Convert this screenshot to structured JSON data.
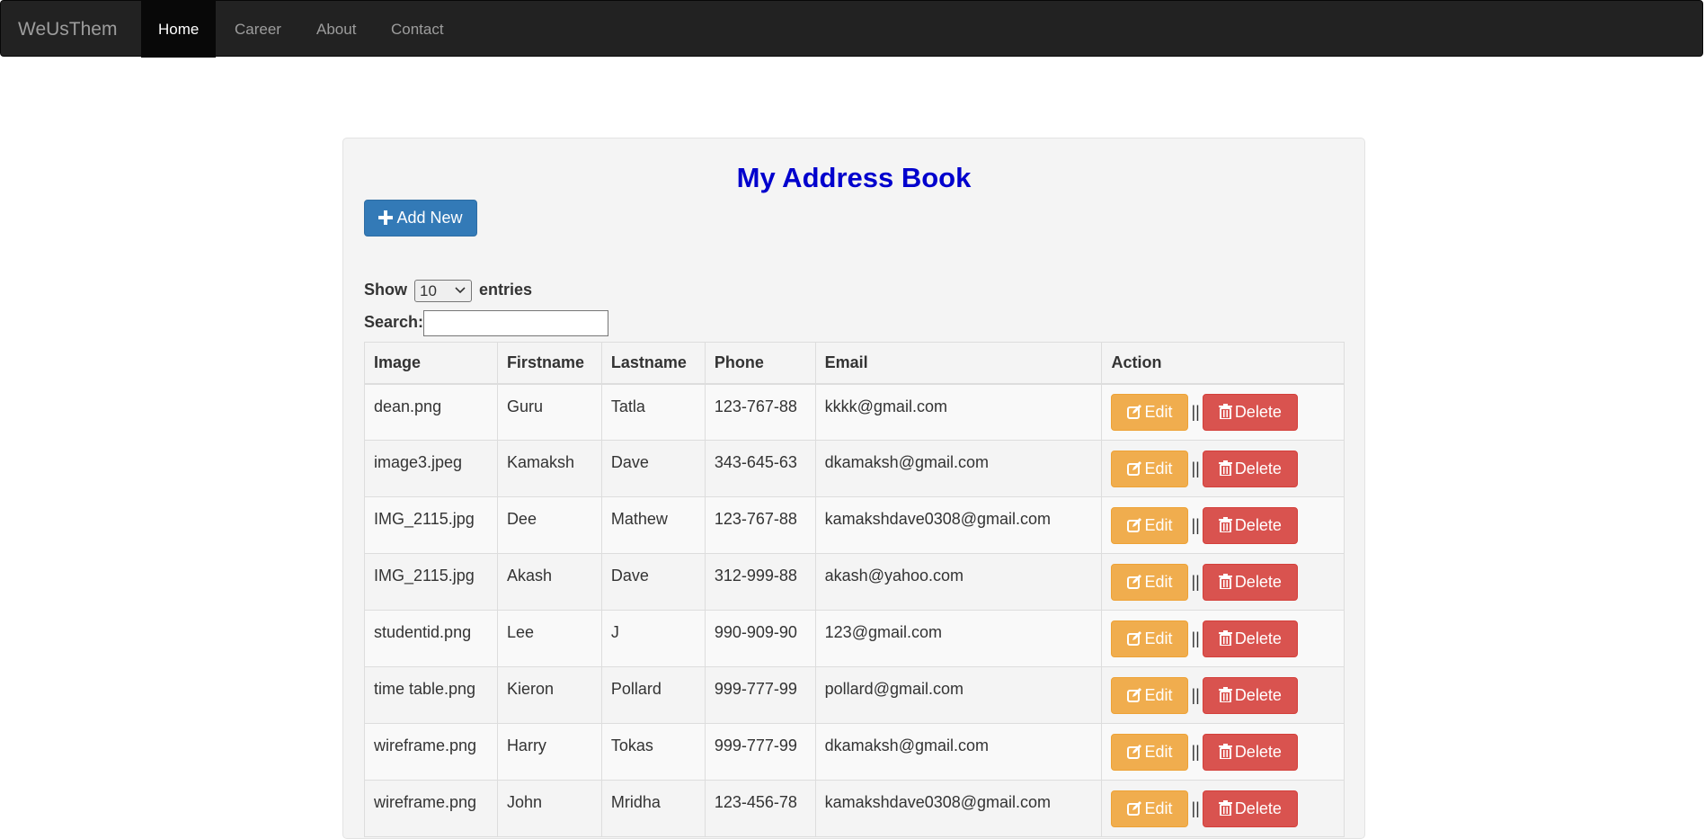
{
  "nav": {
    "brand": "WeUsThem",
    "items": [
      {
        "label": "Home"
      },
      {
        "label": "Career"
      },
      {
        "label": "About"
      },
      {
        "label": "Contact"
      }
    ]
  },
  "page": {
    "title": "My Address Book",
    "add_button_label": "Add New"
  },
  "controls": {
    "show_label": "Show",
    "entries_value": "10",
    "entries_label": "entries",
    "search_label": "Search:",
    "search_value": ""
  },
  "table": {
    "headers": [
      "Image",
      "Firstname",
      "Lastname",
      "Phone",
      "Email",
      "Action"
    ],
    "edit_label": "Edit",
    "delete_label": "Delete",
    "separator": "||",
    "rows": [
      {
        "image": "dean.png",
        "firstname": "Guru",
        "lastname": "Tatla",
        "phone": "123-767-88",
        "email": "kkkk@gmail.com"
      },
      {
        "image": "image3.jpeg",
        "firstname": "Kamaksh",
        "lastname": "Dave",
        "phone": "343-645-63",
        "email": "dkamaksh@gmail.com"
      },
      {
        "image": "IMG_2115.jpg",
        "firstname": "Dee",
        "lastname": "Mathew",
        "phone": "123-767-88",
        "email": "kamakshdave0308@gmail.com"
      },
      {
        "image": "IMG_2115.jpg",
        "firstname": "Akash",
        "lastname": "Dave",
        "phone": "312-999-88",
        "email": "akash@yahoo.com"
      },
      {
        "image": "studentid.png",
        "firstname": "Lee",
        "lastname": "J",
        "phone": "990-909-90",
        "email": "123@gmail.com"
      },
      {
        "image": "time table.png",
        "firstname": "Kieron",
        "lastname": "Pollard",
        "phone": "999-777-99",
        "email": "pollard@gmail.com"
      },
      {
        "image": "wireframe.png",
        "firstname": "Harry",
        "lastname": "Tokas",
        "phone": "999-777-99",
        "email": "dkamaksh@gmail.com"
      },
      {
        "image": "wireframe.png",
        "firstname": "John",
        "lastname": "Mridha",
        "phone": "123-456-78",
        "email": "kamakshdave0308@gmail.com"
      }
    ]
  },
  "colors": {
    "title": "#0000cd",
    "primary": "#337ab7",
    "warning": "#f0ad4e",
    "danger": "#d9534f",
    "navbar": "#222222"
  },
  "icons": {
    "add": "plus-icon",
    "edit": "edit-icon",
    "delete": "trash-icon"
  }
}
